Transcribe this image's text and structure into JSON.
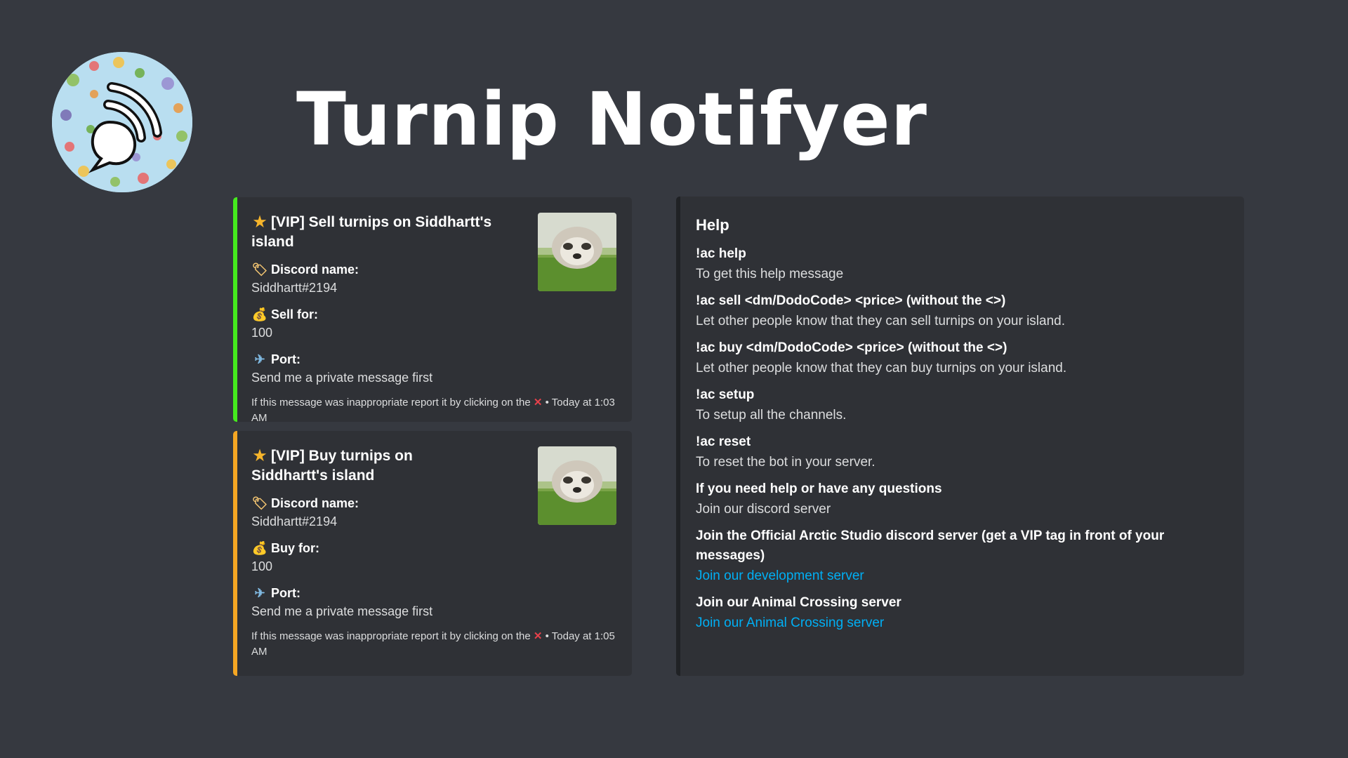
{
  "header": {
    "title": "Turnip Notifyer",
    "logo_icon": "rss-bubble-icon"
  },
  "colors": {
    "background": "#363940",
    "embed_bg": "#2f3136",
    "sell_accent": "#45ea1e",
    "buy_accent": "#f5a623",
    "link": "#00aff4",
    "report_x": "#e8414b"
  },
  "sell_embed": {
    "title_icon": "star-icon",
    "title": "[VIP] Sell turnips on Siddhartt's island",
    "thumbnail": "sloth-thumbnail",
    "fields": [
      {
        "icon": "tag-icon",
        "name": "Discord name:",
        "value": "Siddhartt#2194"
      },
      {
        "icon": "money-bag-icon",
        "name": "Sell for:",
        "value": "100"
      },
      {
        "icon": "airplane-icon",
        "name": "Port:",
        "value": "Send me a private message first"
      }
    ],
    "footer_text": "If this message was inappropriate report it by clicking on the",
    "footer_icon": "cross-mark-icon",
    "footer_time": "• Today at 1:03 AM"
  },
  "buy_embed": {
    "title_icon": "star-icon",
    "title": "[VIP] Buy turnips on Siddhartt's island",
    "thumbnail": "sloth-thumbnail",
    "fields": [
      {
        "icon": "tag-icon",
        "name": "Discord name:",
        "value": "Siddhartt#2194"
      },
      {
        "icon": "money-bag-icon",
        "name": "Buy for:",
        "value": "100"
      },
      {
        "icon": "airplane-icon",
        "name": "Port:",
        "value": "Send me a private message first"
      }
    ],
    "footer_text": "If this message was inappropriate report it by clicking on the",
    "footer_icon": "cross-mark-icon",
    "footer_time": "• Today at 1:05 AM"
  },
  "help_embed": {
    "title": "Help",
    "fields": [
      {
        "name": "!ac help",
        "value": "To get this help message"
      },
      {
        "name": "!ac sell <dm/DodoCode> <price> (without the <>)",
        "value": "Let other people know that they can sell turnips on your island."
      },
      {
        "name": "!ac buy <dm/DodoCode> <price> (without the <>)",
        "value": "Let other people know that they can buy turnips on your island."
      },
      {
        "name": "!ac setup",
        "value": "To setup all the channels."
      },
      {
        "name": "!ac reset",
        "value": "To reset the bot in your server."
      },
      {
        "name": "If you need help or have any questions",
        "value": "Join our discord server"
      },
      {
        "name": "Join the Official Arctic Studio discord server (get a VIP tag in front of your messages)",
        "link": "Join our development server"
      },
      {
        "name": "Join our Animal Crossing server",
        "link": "Join our Animal Crossing server"
      }
    ]
  }
}
